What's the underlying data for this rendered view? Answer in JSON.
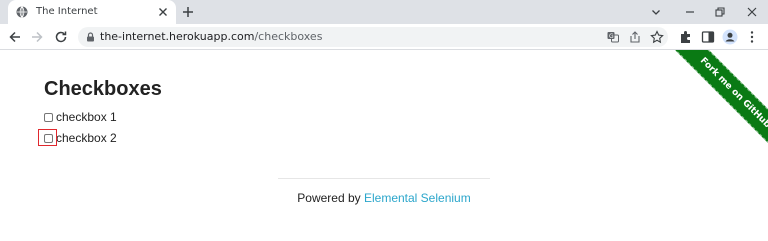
{
  "browser": {
    "tab_title": "The Internet",
    "url_host": "the-internet.herokuapp.com",
    "url_path": "/checkboxes"
  },
  "page": {
    "title": "Checkboxes",
    "checkboxes": [
      {
        "label": "checkbox 1",
        "checked": false
      },
      {
        "label": "checkbox 2",
        "checked": false
      }
    ],
    "footer_prefix": "Powered by ",
    "footer_link": "Elemental Selenium",
    "ribbon": "Fork me on GitHub"
  },
  "colors": {
    "link": "#2ba6cb",
    "ribbon": "#0a7a14",
    "highlight": "#e0282e"
  }
}
